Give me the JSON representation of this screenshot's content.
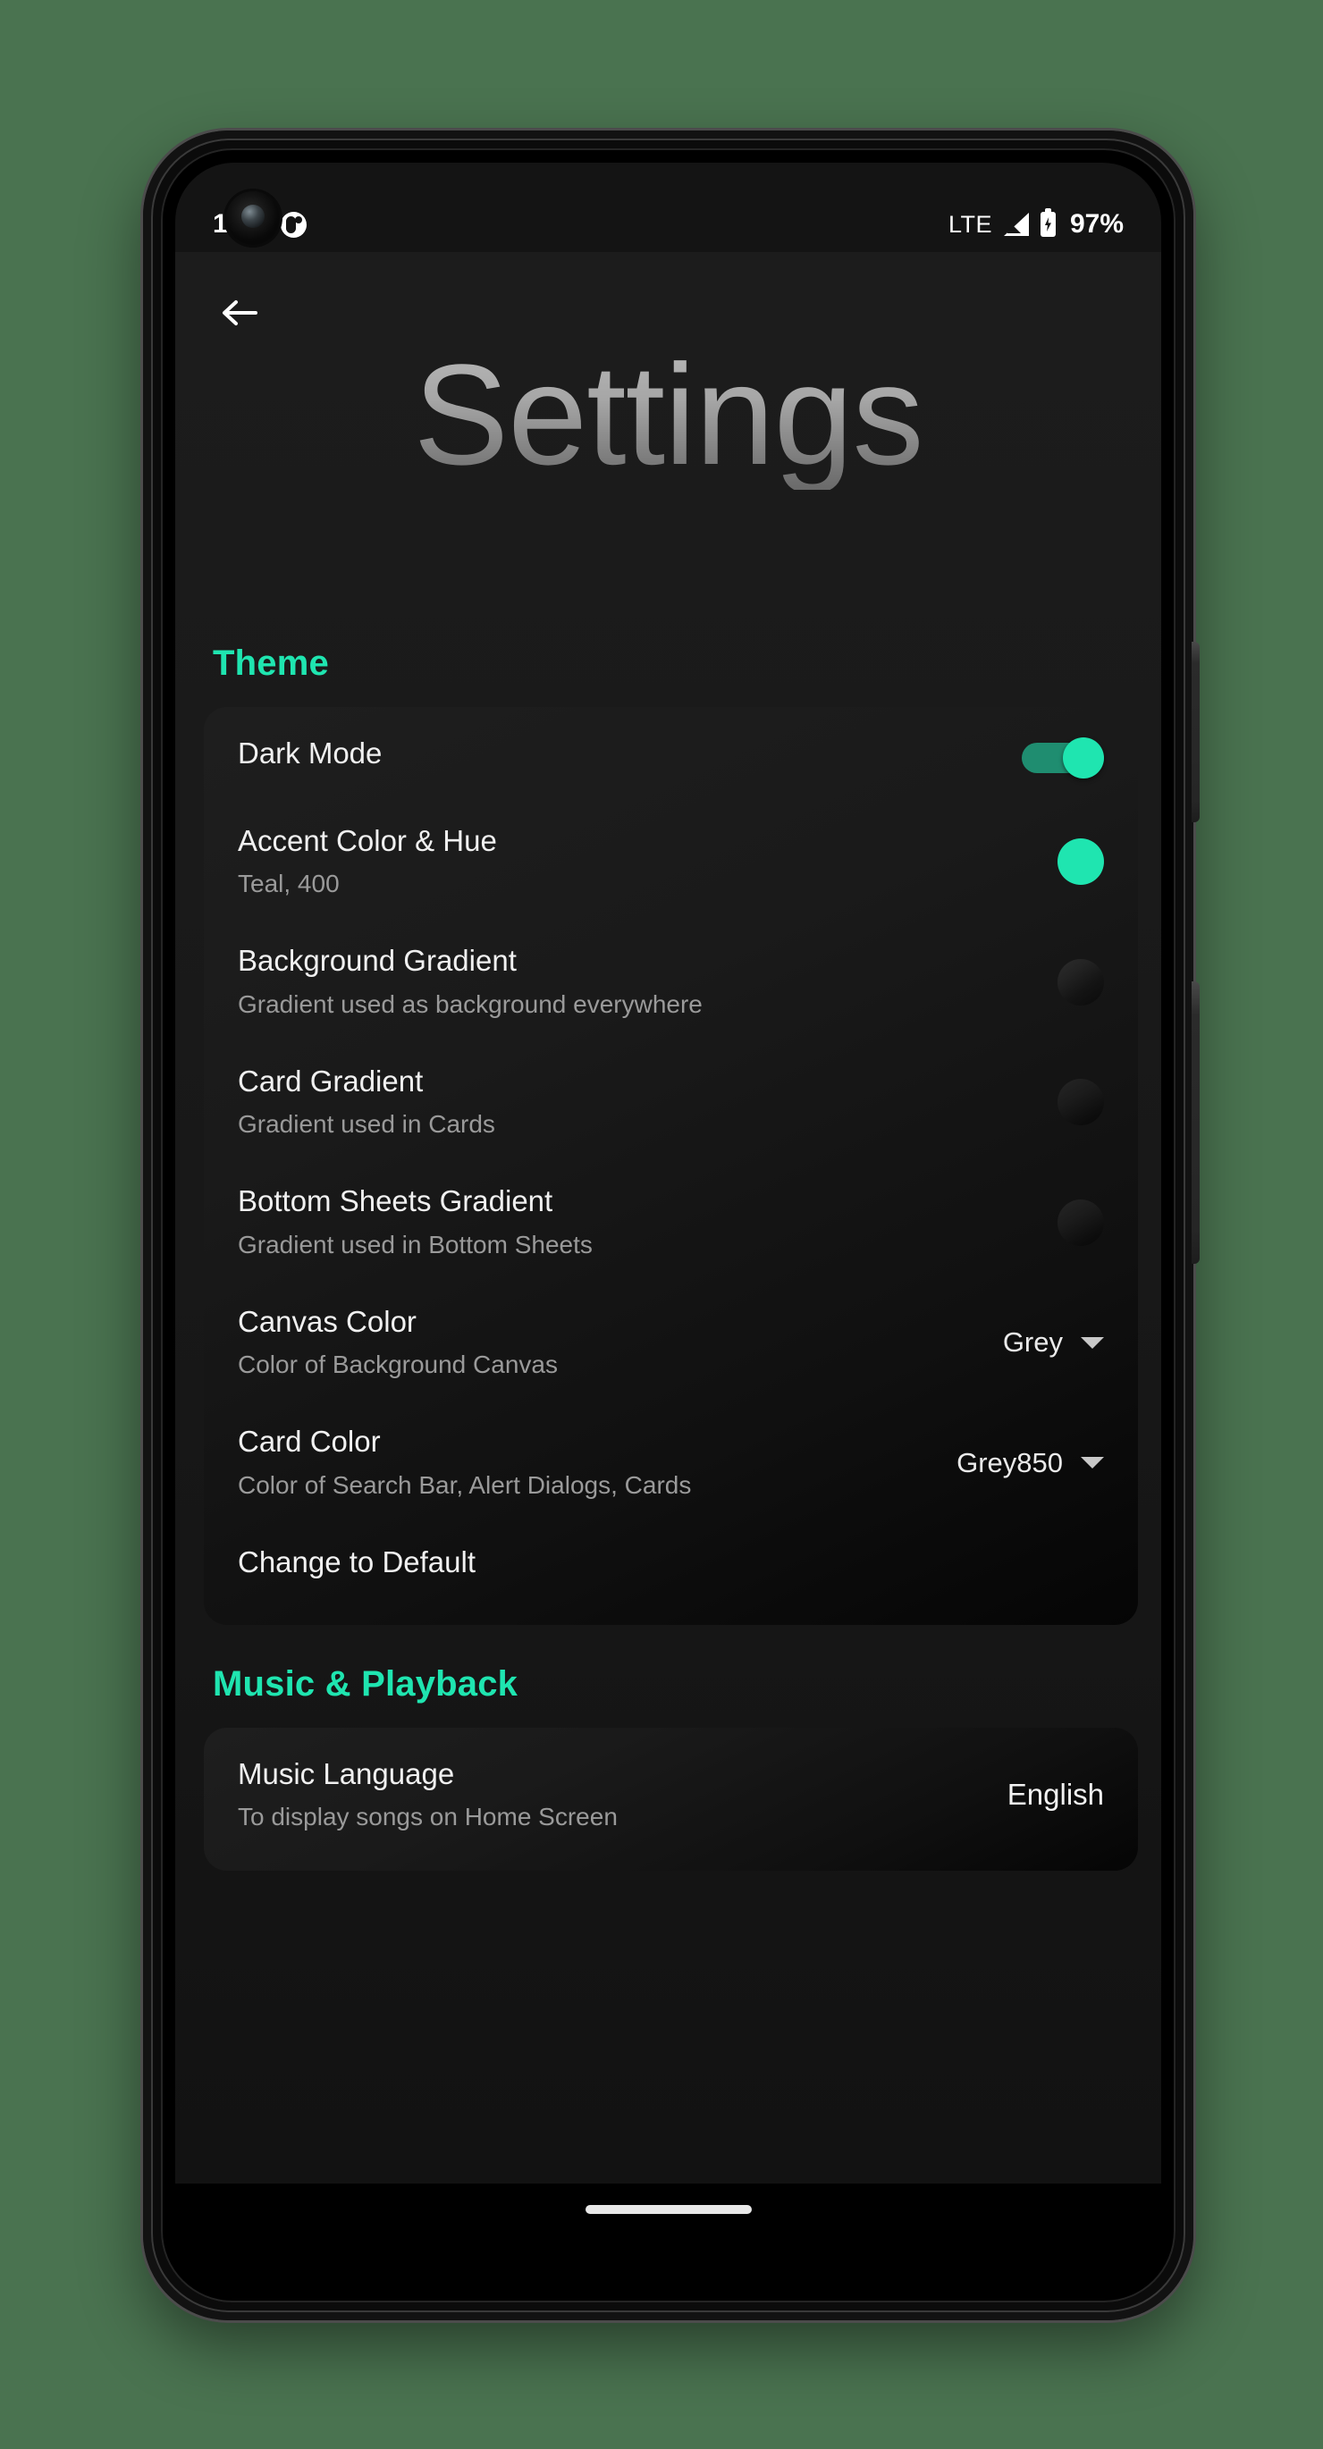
{
  "status_bar": {
    "time": "1:11",
    "notification_icon": "app-notification-icon",
    "network_label": "LTE",
    "signal_icon": "signal-bars-icon",
    "battery_icon": "battery-charging-icon",
    "battery_percent": "97%"
  },
  "header": {
    "back_icon": "back-arrow-icon",
    "title": "Settings"
  },
  "sections": [
    {
      "label": "Theme",
      "rows": [
        {
          "title": "Dark Mode",
          "subtitle": "",
          "trail_type": "switch",
          "trail_value": "on"
        },
        {
          "title": "Accent Color & Hue",
          "subtitle": "Teal, 400",
          "trail_type": "color-dot",
          "trail_value": "#1FE5B0"
        },
        {
          "title": "Background Gradient",
          "subtitle": "Gradient used as background everywhere",
          "trail_type": "gradient-dot",
          "trail_value": ""
        },
        {
          "title": "Card Gradient",
          "subtitle": "Gradient used in Cards",
          "trail_type": "gradient-dot",
          "trail_value": ""
        },
        {
          "title": "Bottom Sheets Gradient",
          "subtitle": "Gradient used in Bottom Sheets",
          "trail_type": "gradient-dot",
          "trail_value": ""
        },
        {
          "title": "Canvas Color",
          "subtitle": "Color of Background Canvas",
          "trail_type": "dropdown",
          "trail_value": "Grey"
        },
        {
          "title": "Card Color",
          "subtitle": "Color of Search Bar, Alert Dialogs, Cards",
          "trail_type": "dropdown",
          "trail_value": "Grey850"
        },
        {
          "title": "Change to Default",
          "subtitle": "",
          "trail_type": "none",
          "trail_value": ""
        }
      ]
    },
    {
      "label": "Music & Playback",
      "rows": [
        {
          "title": "Music Language",
          "subtitle": "To display songs on Home Screen",
          "trail_type": "plain",
          "trail_value": "English"
        }
      ]
    }
  ],
  "colors": {
    "accent": "#1FE5B0",
    "page_background": "#4A7350",
    "card_background": "#1A1A1A",
    "title_text": "#A6A6A6",
    "subtitle_text": "#9A9A9A"
  },
  "gesture_bar": "home-gesture-bar"
}
